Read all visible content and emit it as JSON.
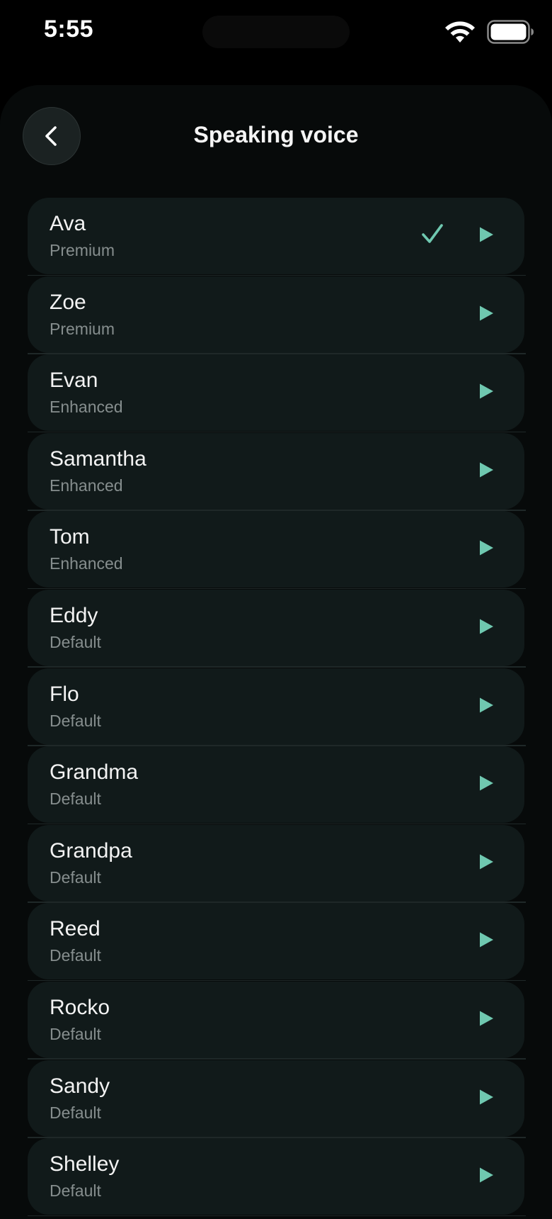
{
  "status_bar": {
    "time": "5:55"
  },
  "header": {
    "title": "Speaking voice"
  },
  "colors": {
    "accent": "#6fc8b0",
    "background": "#000000",
    "row_background": "#111a1a"
  },
  "icons": {
    "back": "chevron-left-icon",
    "selected": "checkmark-icon",
    "play": "play-icon"
  },
  "voices": [
    {
      "name": "Ava",
      "tier": "Premium",
      "selected": true
    },
    {
      "name": "Zoe",
      "tier": "Premium",
      "selected": false
    },
    {
      "name": "Evan",
      "tier": "Enhanced",
      "selected": false
    },
    {
      "name": "Samantha",
      "tier": "Enhanced",
      "selected": false
    },
    {
      "name": "Tom",
      "tier": "Enhanced",
      "selected": false
    },
    {
      "name": "Eddy",
      "tier": "Default",
      "selected": false
    },
    {
      "name": "Flo",
      "tier": "Default",
      "selected": false
    },
    {
      "name": "Grandma",
      "tier": "Default",
      "selected": false
    },
    {
      "name": "Grandpa",
      "tier": "Default",
      "selected": false
    },
    {
      "name": "Reed",
      "tier": "Default",
      "selected": false
    },
    {
      "name": "Rocko",
      "tier": "Default",
      "selected": false
    },
    {
      "name": "Sandy",
      "tier": "Default",
      "selected": false
    },
    {
      "name": "Shelley",
      "tier": "Default",
      "selected": false
    }
  ]
}
